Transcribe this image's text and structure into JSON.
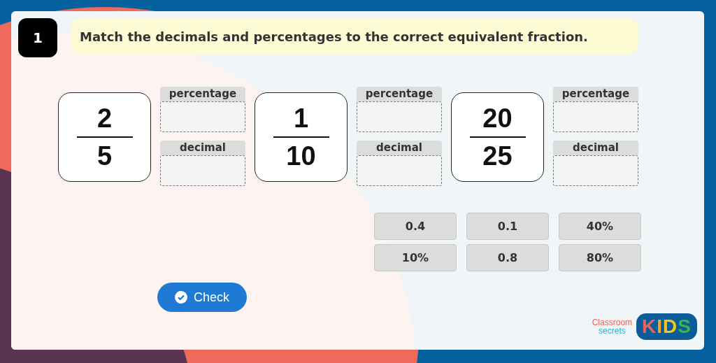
{
  "question": {
    "number": "1",
    "instruction": "Match the decimals and percentages to the correct equivalent fraction."
  },
  "fractions": [
    {
      "numerator": "2",
      "denominator": "5",
      "slots": [
        {
          "label": "percentage"
        },
        {
          "label": "decimal"
        }
      ]
    },
    {
      "numerator": "1",
      "denominator": "10",
      "slots": [
        {
          "label": "percentage"
        },
        {
          "label": "decimal"
        }
      ]
    },
    {
      "numerator": "20",
      "denominator": "25",
      "slots": [
        {
          "label": "percentage"
        },
        {
          "label": "decimal"
        }
      ]
    }
  ],
  "tiles": [
    "0.4",
    "0.1",
    "40%",
    "10%",
    "0.8",
    "80%"
  ],
  "check_button": {
    "label": "Check"
  },
  "logo": {
    "line_1": "Classroom",
    "line_2": "secrets",
    "badge": "KIDS"
  }
}
